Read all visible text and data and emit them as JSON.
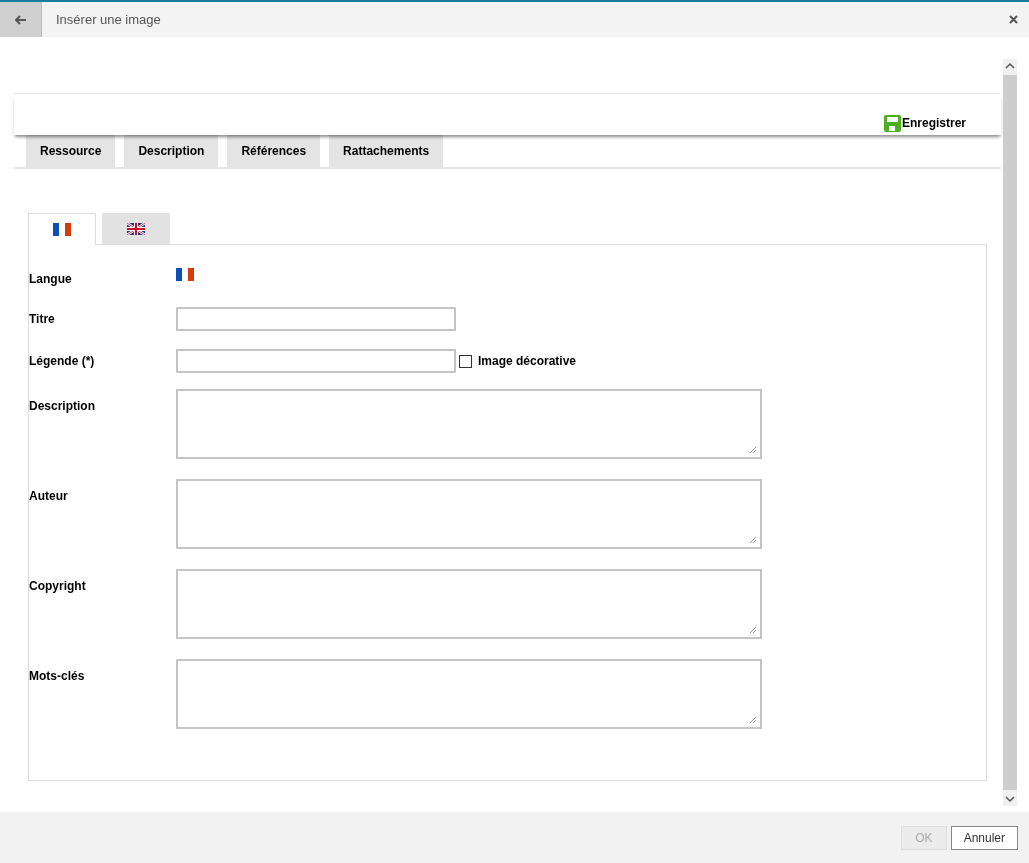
{
  "window": {
    "title": "Insérer une image"
  },
  "save_button": {
    "label": "Enregistrer"
  },
  "tabs": [
    {
      "label": "Ressource",
      "selected": false
    },
    {
      "label": "Description",
      "selected": false
    },
    {
      "label": "Références",
      "selected": false
    },
    {
      "label": "Rattachements",
      "selected": false
    }
  ],
  "language_tabs": [
    {
      "kind": "fr",
      "selected": true
    },
    {
      "kind": "gb",
      "selected": false
    }
  ],
  "fields": [
    {
      "kind": "flag",
      "label": "Langue"
    },
    {
      "kind": "text",
      "label": "Titre"
    },
    {
      "kind": "text_checkbox",
      "label": "Légende (*)",
      "checkbox": {
        "label": "Image décorative",
        "checked": false
      }
    },
    {
      "kind": "textarea",
      "label": "Description"
    },
    {
      "kind": "textarea",
      "label": "Auteur"
    },
    {
      "kind": "textarea",
      "label": "Copyright"
    },
    {
      "kind": "textarea",
      "label": "Mots-clés"
    }
  ],
  "buttons": [
    {
      "label": "OK",
      "disabled": true
    },
    {
      "label": "Annuler",
      "disabled": false
    }
  ]
}
